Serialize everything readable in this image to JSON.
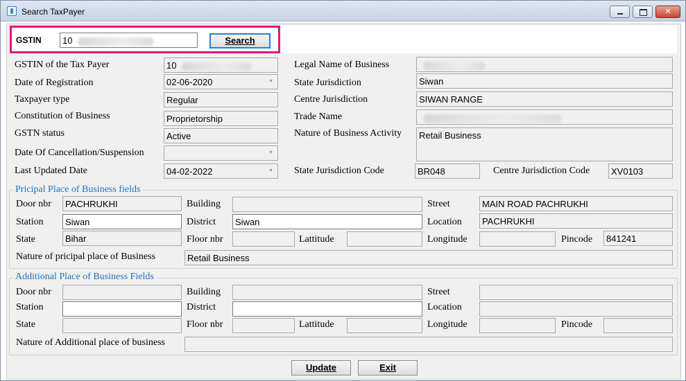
{
  "window": {
    "title": "Search TaxPayer",
    "close_glyph": "✕"
  },
  "search": {
    "label": "GSTIN",
    "value": "10",
    "button": "Search"
  },
  "taxpayer": {
    "gstin_label": "GSTIN of the Tax Payer",
    "gstin_value": "10",
    "reg_date_label": "Date of Registration",
    "reg_date_value": "02-06-2020",
    "type_label": "Taxpayer type",
    "type_value": "Regular",
    "constitution_label": "Constitution of Business",
    "constitution_value": "Proprietorship",
    "status_label": "GSTN status",
    "status_value": "Active",
    "cancel_label": "Date Of Cancellation/Suspension",
    "cancel_value": "",
    "updated_label": "Last Updated Date",
    "updated_value": "04-02-2022",
    "legal_name_label": "Legal Name of Business",
    "legal_name_value": "",
    "state_jur_label": "State Jurisdiction",
    "state_jur_value": "Siwan",
    "centre_jur_label": "Centre Jurisdiction",
    "centre_jur_value": "SIWAN RANGE",
    "trade_name_label": "Trade Name",
    "trade_name_value": "",
    "nature_label": "Nature of Business Activity",
    "nature_value": "Retail Business",
    "state_code_label": "State Jurisdiction Code",
    "state_code_value": "BR048",
    "centre_code_label": "Centre Jurisdiction Code",
    "centre_code_value": "XV0103"
  },
  "principal": {
    "title": "Pricipal Place of Business fields",
    "door_label": "Door nbr",
    "door_value": "PACHRUKHI",
    "building_label": "Building",
    "building_value": "",
    "street_label": "Street",
    "street_value": "MAIN ROAD PACHRUKHI",
    "station_label": "Station",
    "station_value": "Siwan",
    "district_label": "District",
    "district_value": "Siwan",
    "location_label": "Location",
    "location_value": "PACHRUKHI",
    "state_label": "State",
    "state_value": "Bihar",
    "floor_label": "Floor nbr",
    "floor_value": "",
    "lat_label": "Lattitude",
    "lat_value": "",
    "long_label": "Longitude",
    "long_value": "",
    "pin_label": "Pincode",
    "pin_value": "841241",
    "nature_label": "Nature of pricipal place of Business",
    "nature_value": "Retail Business"
  },
  "additional": {
    "title": "Additional Place of Business Fields",
    "door_label": "Door nbr",
    "building_label": "Building",
    "street_label": "Street",
    "station_label": "Station",
    "district_label": "District",
    "location_label": "Location",
    "state_label": "State",
    "floor_label": "Floor nbr",
    "lat_label": "Lattitude",
    "long_label": "Longitude",
    "pin_label": "Pincode",
    "nature_label": "Nature of Additional place of business"
  },
  "buttons": {
    "update": "Update",
    "exit": "Exit"
  },
  "icons": {
    "app": "taxpayer-app-icon",
    "minimize": "minimize-icon",
    "maximize": "maximize-icon",
    "close": "close-icon",
    "dropdown": "chevron-down-icon"
  }
}
